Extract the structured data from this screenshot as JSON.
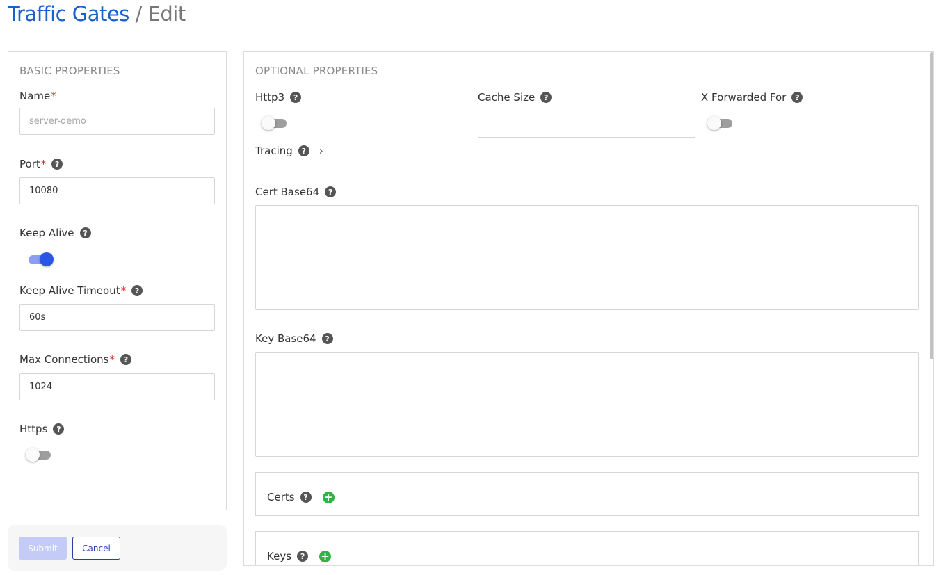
{
  "header": {
    "link": "Traffic Gates",
    "separator": "/",
    "current": "Edit"
  },
  "basic": {
    "title": "BASIC PROPERTIES",
    "name": {
      "label": "Name",
      "required": "*",
      "value": "",
      "placeholder": "server-demo"
    },
    "port": {
      "label": "Port",
      "required": "*",
      "value": "10080"
    },
    "keep_alive": {
      "label": "Keep Alive",
      "on": true
    },
    "keep_alive_timeout": {
      "label": "Keep Alive Timeout",
      "required": "*",
      "value": "60s"
    },
    "max_connections": {
      "label": "Max Connections",
      "required": "*",
      "value": "1024"
    },
    "https": {
      "label": "Https",
      "on": false
    }
  },
  "optional": {
    "title": "OPTIONAL PROPERTIES",
    "http3": {
      "label": "Http3",
      "on": false
    },
    "cache_size": {
      "label": "Cache Size",
      "value": ""
    },
    "x_forwarded_for": {
      "label": "X Forwarded For",
      "on": false
    },
    "tracing": {
      "label": "Tracing"
    },
    "cert_base64": {
      "label": "Cert Base64",
      "value": ""
    },
    "key_base64": {
      "label": "Key Base64",
      "value": ""
    },
    "certs": {
      "label": "Certs"
    },
    "keys": {
      "label": "Keys"
    }
  },
  "actions": {
    "submit": "Submit",
    "cancel": "Cancel"
  },
  "icons": {
    "help": "?",
    "chevron": "›",
    "add": "+"
  },
  "colors": {
    "primary": "#2b55e5",
    "link": "#1a5fcb",
    "required": "#e02424",
    "add": "#2fb344",
    "submit_disabled": "#c4cbf6"
  }
}
